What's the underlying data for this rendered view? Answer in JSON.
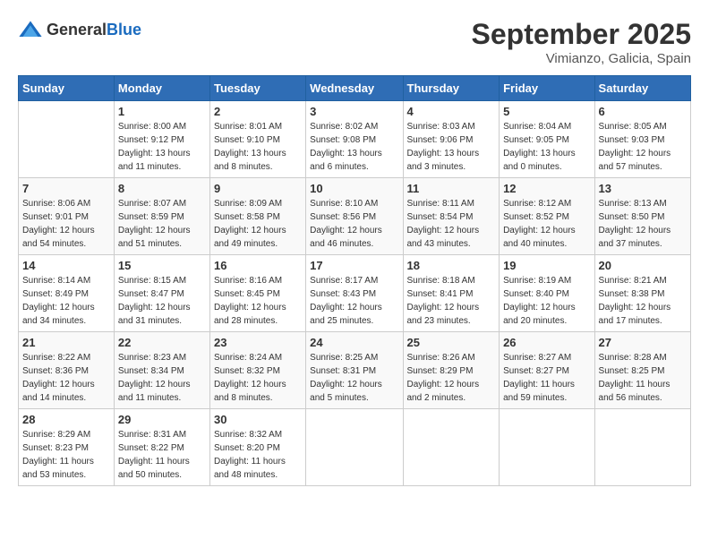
{
  "logo": {
    "general": "General",
    "blue": "Blue"
  },
  "title": "September 2025",
  "location": "Vimianzo, Galicia, Spain",
  "days_of_week": [
    "Sunday",
    "Monday",
    "Tuesday",
    "Wednesday",
    "Thursday",
    "Friday",
    "Saturday"
  ],
  "weeks": [
    [
      {
        "day": "",
        "info": ""
      },
      {
        "day": "1",
        "info": "Sunrise: 8:00 AM\nSunset: 9:12 PM\nDaylight: 13 hours\nand 11 minutes."
      },
      {
        "day": "2",
        "info": "Sunrise: 8:01 AM\nSunset: 9:10 PM\nDaylight: 13 hours\nand 8 minutes."
      },
      {
        "day": "3",
        "info": "Sunrise: 8:02 AM\nSunset: 9:08 PM\nDaylight: 13 hours\nand 6 minutes."
      },
      {
        "day": "4",
        "info": "Sunrise: 8:03 AM\nSunset: 9:06 PM\nDaylight: 13 hours\nand 3 minutes."
      },
      {
        "day": "5",
        "info": "Sunrise: 8:04 AM\nSunset: 9:05 PM\nDaylight: 13 hours\nand 0 minutes."
      },
      {
        "day": "6",
        "info": "Sunrise: 8:05 AM\nSunset: 9:03 PM\nDaylight: 12 hours\nand 57 minutes."
      }
    ],
    [
      {
        "day": "7",
        "info": "Sunrise: 8:06 AM\nSunset: 9:01 PM\nDaylight: 12 hours\nand 54 minutes."
      },
      {
        "day": "8",
        "info": "Sunrise: 8:07 AM\nSunset: 8:59 PM\nDaylight: 12 hours\nand 51 minutes."
      },
      {
        "day": "9",
        "info": "Sunrise: 8:09 AM\nSunset: 8:58 PM\nDaylight: 12 hours\nand 49 minutes."
      },
      {
        "day": "10",
        "info": "Sunrise: 8:10 AM\nSunset: 8:56 PM\nDaylight: 12 hours\nand 46 minutes."
      },
      {
        "day": "11",
        "info": "Sunrise: 8:11 AM\nSunset: 8:54 PM\nDaylight: 12 hours\nand 43 minutes."
      },
      {
        "day": "12",
        "info": "Sunrise: 8:12 AM\nSunset: 8:52 PM\nDaylight: 12 hours\nand 40 minutes."
      },
      {
        "day": "13",
        "info": "Sunrise: 8:13 AM\nSunset: 8:50 PM\nDaylight: 12 hours\nand 37 minutes."
      }
    ],
    [
      {
        "day": "14",
        "info": "Sunrise: 8:14 AM\nSunset: 8:49 PM\nDaylight: 12 hours\nand 34 minutes."
      },
      {
        "day": "15",
        "info": "Sunrise: 8:15 AM\nSunset: 8:47 PM\nDaylight: 12 hours\nand 31 minutes."
      },
      {
        "day": "16",
        "info": "Sunrise: 8:16 AM\nSunset: 8:45 PM\nDaylight: 12 hours\nand 28 minutes."
      },
      {
        "day": "17",
        "info": "Sunrise: 8:17 AM\nSunset: 8:43 PM\nDaylight: 12 hours\nand 25 minutes."
      },
      {
        "day": "18",
        "info": "Sunrise: 8:18 AM\nSunset: 8:41 PM\nDaylight: 12 hours\nand 23 minutes."
      },
      {
        "day": "19",
        "info": "Sunrise: 8:19 AM\nSunset: 8:40 PM\nDaylight: 12 hours\nand 20 minutes."
      },
      {
        "day": "20",
        "info": "Sunrise: 8:21 AM\nSunset: 8:38 PM\nDaylight: 12 hours\nand 17 minutes."
      }
    ],
    [
      {
        "day": "21",
        "info": "Sunrise: 8:22 AM\nSunset: 8:36 PM\nDaylight: 12 hours\nand 14 minutes."
      },
      {
        "day": "22",
        "info": "Sunrise: 8:23 AM\nSunset: 8:34 PM\nDaylight: 12 hours\nand 11 minutes."
      },
      {
        "day": "23",
        "info": "Sunrise: 8:24 AM\nSunset: 8:32 PM\nDaylight: 12 hours\nand 8 minutes."
      },
      {
        "day": "24",
        "info": "Sunrise: 8:25 AM\nSunset: 8:31 PM\nDaylight: 12 hours\nand 5 minutes."
      },
      {
        "day": "25",
        "info": "Sunrise: 8:26 AM\nSunset: 8:29 PM\nDaylight: 12 hours\nand 2 minutes."
      },
      {
        "day": "26",
        "info": "Sunrise: 8:27 AM\nSunset: 8:27 PM\nDaylight: 11 hours\nand 59 minutes."
      },
      {
        "day": "27",
        "info": "Sunrise: 8:28 AM\nSunset: 8:25 PM\nDaylight: 11 hours\nand 56 minutes."
      }
    ],
    [
      {
        "day": "28",
        "info": "Sunrise: 8:29 AM\nSunset: 8:23 PM\nDaylight: 11 hours\nand 53 minutes."
      },
      {
        "day": "29",
        "info": "Sunrise: 8:31 AM\nSunset: 8:22 PM\nDaylight: 11 hours\nand 50 minutes."
      },
      {
        "day": "30",
        "info": "Sunrise: 8:32 AM\nSunset: 8:20 PM\nDaylight: 11 hours\nand 48 minutes."
      },
      {
        "day": "",
        "info": ""
      },
      {
        "day": "",
        "info": ""
      },
      {
        "day": "",
        "info": ""
      },
      {
        "day": "",
        "info": ""
      }
    ]
  ]
}
